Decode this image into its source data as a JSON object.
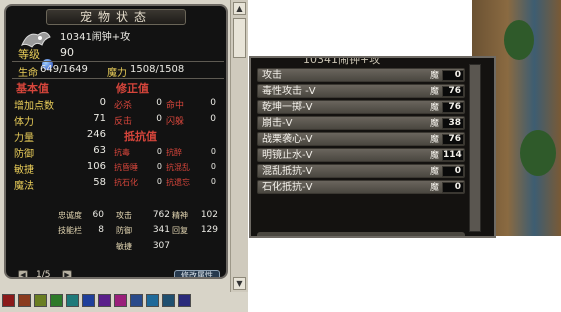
{
  "pet_status": {
    "title": "宠物状态",
    "name": "10341闹钟+攻",
    "level_label": "等级",
    "level": "90",
    "hp_label": "生命",
    "hp": "649/1649",
    "mp_label": "魔力",
    "mp": "1508/1508",
    "base_title": "基本值",
    "base_stats": [
      {
        "label": "增加点数",
        "value": "0"
      },
      {
        "label": "体力",
        "value": "71"
      },
      {
        "label": "力量",
        "value": "246"
      },
      {
        "label": "防御",
        "value": "63"
      },
      {
        "label": "敏捷",
        "value": "106"
      },
      {
        "label": "魔法",
        "value": "58"
      }
    ],
    "mod_title": "修正值",
    "mod_stats": [
      {
        "label": "必杀",
        "value": "0",
        "label2": "命中",
        "value2": "0"
      },
      {
        "label": "反击",
        "value": "0",
        "label2": "闪躲",
        "value2": "0"
      }
    ],
    "resist_title": "抵抗值",
    "resist_stats": [
      {
        "label": "抗毒",
        "value": "0",
        "label2": "抗醉",
        "value2": "0"
      },
      {
        "label": "抗昏睡",
        "value": "0",
        "label2": "抗混乱",
        "value2": "0"
      },
      {
        "label": "抗石化",
        "value": "0",
        "label2": "抗遗忘",
        "value2": "0"
      }
    ],
    "bottom_left": [
      {
        "label": "忠诚度",
        "value": "60"
      },
      {
        "label": "技能栏",
        "value": "8"
      }
    ],
    "bottom_right": [
      {
        "label": "攻击",
        "value": "762",
        "label2": "精神",
        "value2": "102"
      },
      {
        "label": "防御",
        "value": "341",
        "label2": "回复",
        "value2": "129"
      },
      {
        "label": "敏捷",
        "value": "307"
      }
    ],
    "page_indicator": "1/5",
    "side_button_label": "修改属性"
  },
  "skill_window": {
    "top_text": "10341闹钟+攻",
    "mp_label": "魔",
    "skills": [
      {
        "name": "攻击",
        "mp": "0"
      },
      {
        "name": "毒性攻击 -V",
        "mp": "76"
      },
      {
        "name": "乾坤一掷-V",
        "mp": "76"
      },
      {
        "name": "崩击-V",
        "mp": "38"
      },
      {
        "name": "战栗袭心-V",
        "mp": "76"
      },
      {
        "name": "明镜止水-V",
        "mp": "114"
      },
      {
        "name": "混乱抵抗-V",
        "mp": "0"
      },
      {
        "name": "石化抵抗-V",
        "mp": "0"
      }
    ]
  },
  "colors": {
    "panel_bg": "#121212",
    "label_yellow": "#e9cd59",
    "label_red": "#d6453b",
    "value_white": "#ecebe5",
    "frame": "#6e6a64"
  },
  "palette": [
    "#8b1a1a",
    "#8a3b1e",
    "#6a7e22",
    "#2e7a2a",
    "#1f7a7a",
    "#1f3f9a",
    "#5a1f8a",
    "#9a1f7a",
    "#2a4a8a",
    "#1f6a9a",
    "#1f4f6f",
    "#2a2a7a",
    "#4a2a6a",
    "#8a5a1a"
  ]
}
